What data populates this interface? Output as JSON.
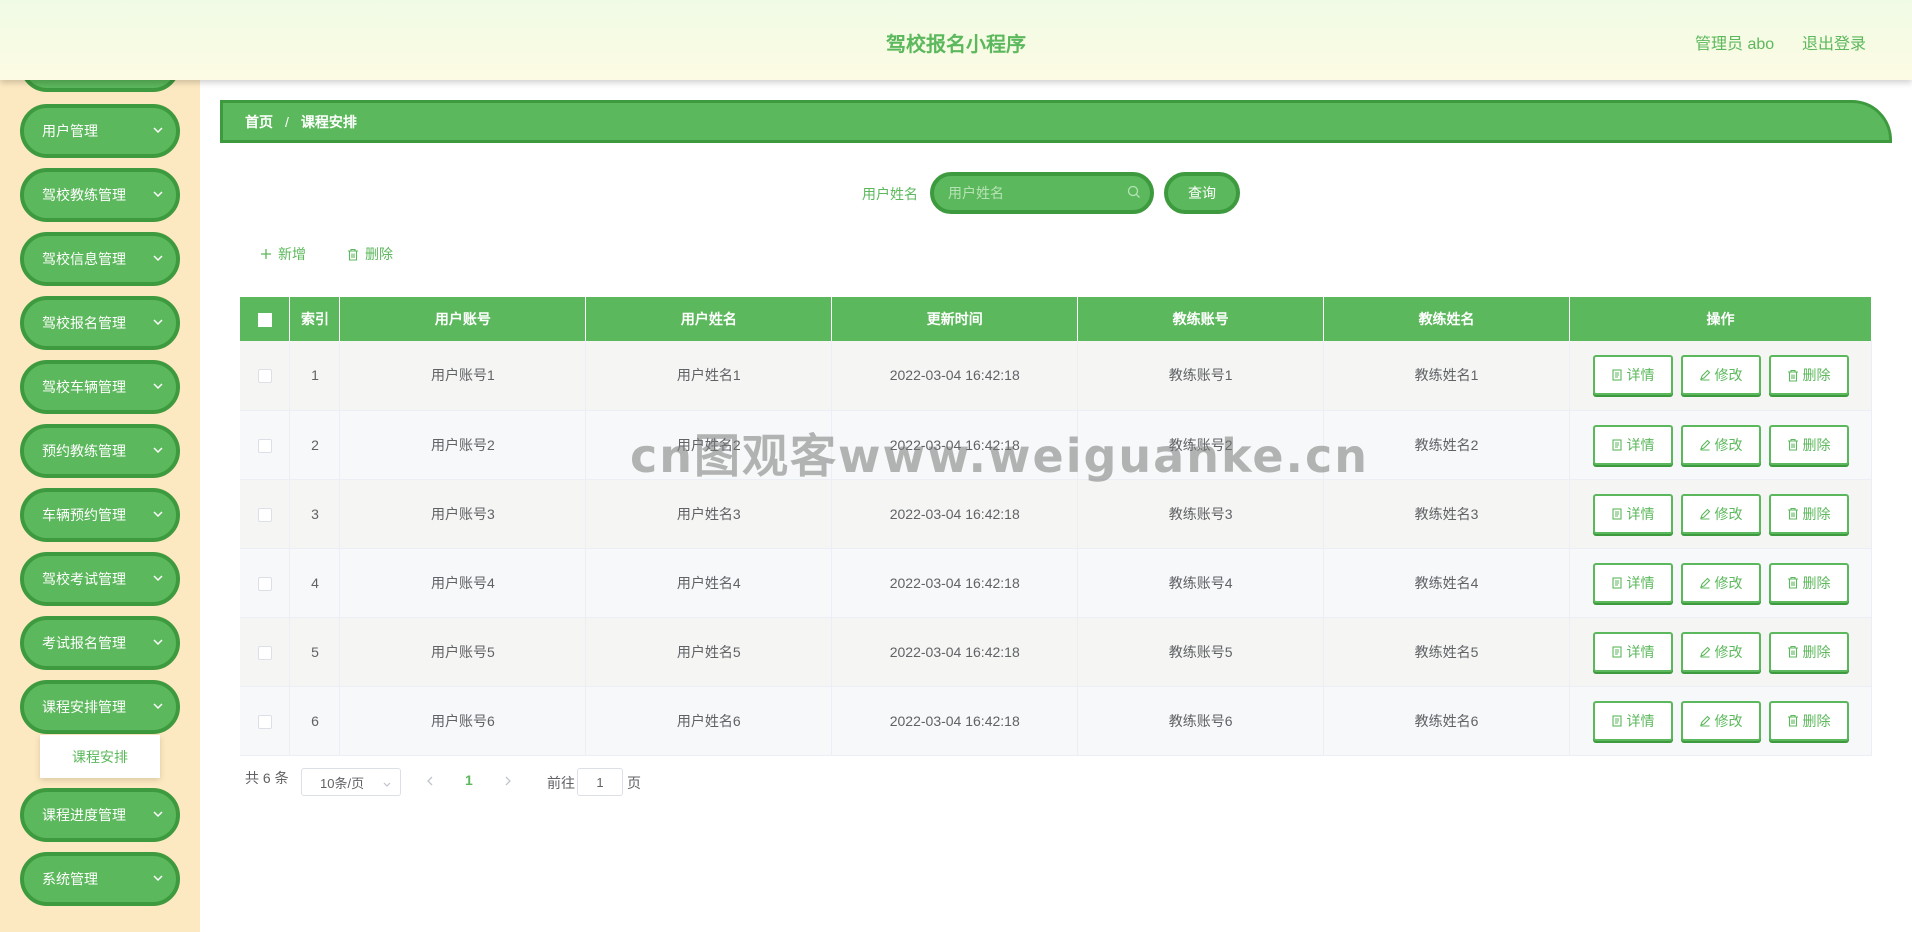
{
  "header": {
    "title": "驾校报名小程序",
    "admin_label": "管理员 abo",
    "logout_label": "退出登录"
  },
  "sidebar": {
    "items": [
      {
        "label": ""
      },
      {
        "label": "用户管理"
      },
      {
        "label": "驾校教练管理"
      },
      {
        "label": "驾校信息管理"
      },
      {
        "label": "驾校报名管理"
      },
      {
        "label": "驾校车辆管理"
      },
      {
        "label": "预约教练管理"
      },
      {
        "label": "车辆预约管理"
      },
      {
        "label": "驾校考试管理"
      },
      {
        "label": "考试报名管理"
      },
      {
        "label": "课程安排管理"
      },
      {
        "label": "课程进度管理"
      },
      {
        "label": "系统管理"
      }
    ],
    "submenu": {
      "label": "课程安排"
    }
  },
  "breadcrumb": {
    "home": "首页",
    "separator": "/",
    "current": "课程安排"
  },
  "search": {
    "label": "用户姓名",
    "placeholder": "用户姓名",
    "button": "查询"
  },
  "toolbar": {
    "add": "新增",
    "delete": "删除"
  },
  "table": {
    "headers": [
      "索引",
      "用户账号",
      "用户姓名",
      "更新时间",
      "教练账号",
      "教练姓名",
      "操作"
    ],
    "rows": [
      {
        "index": "1",
        "user_account": "用户账号1",
        "user_name": "用户姓名1",
        "updated": "2022-03-04 16:42:18",
        "coach_account": "教练账号1",
        "coach_name": "教练姓名1"
      },
      {
        "index": "2",
        "user_account": "用户账号2",
        "user_name": "用户姓名2",
        "updated": "2022-03-04 16:42:18",
        "coach_account": "教练账号2",
        "coach_name": "教练姓名2"
      },
      {
        "index": "3",
        "user_account": "用户账号3",
        "user_name": "用户姓名3",
        "updated": "2022-03-04 16:42:18",
        "coach_account": "教练账号3",
        "coach_name": "教练姓名3"
      },
      {
        "index": "4",
        "user_account": "用户账号4",
        "user_name": "用户姓名4",
        "updated": "2022-03-04 16:42:18",
        "coach_account": "教练账号4",
        "coach_name": "教练姓名4"
      },
      {
        "index": "5",
        "user_account": "用户账号5",
        "user_name": "用户姓名5",
        "updated": "2022-03-04 16:42:18",
        "coach_account": "教练账号5",
        "coach_name": "教练姓名5"
      },
      {
        "index": "6",
        "user_account": "用户账号6",
        "user_name": "用户姓名6",
        "updated": "2022-03-04 16:42:18",
        "coach_account": "教练账号6",
        "coach_name": "教练姓名6"
      }
    ],
    "actions": {
      "detail": "详情",
      "edit": "修改",
      "delete": "删除"
    }
  },
  "pagination": {
    "total": "共 6 条",
    "page_size": "10条/页",
    "current_page": "1",
    "goto_label": "前往",
    "goto_value": "1",
    "page_suffix": "页"
  },
  "watermark": "cn图观客www.weiguanke.cn",
  "colors": {
    "primary": "#5cb85c",
    "primary_dark": "#3e9a3e",
    "sidebar_bg": "#fde9c1"
  }
}
